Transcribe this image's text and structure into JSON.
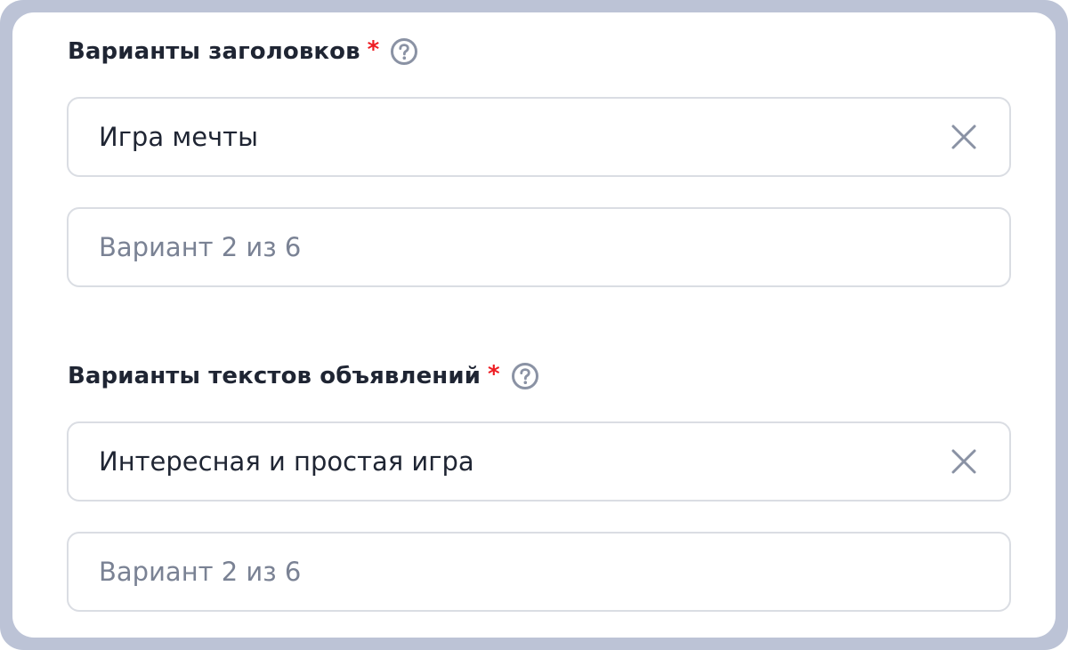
{
  "headlines": {
    "label": "Варианты заголовков",
    "required_mark": "*",
    "help_icon": "question-circle-icon",
    "fields": [
      {
        "value": "Игра мечты",
        "clear_icon": "close-icon"
      },
      {
        "placeholder": "Вариант 2 из 6"
      }
    ]
  },
  "ad_texts": {
    "label": "Варианты текстов объявлений",
    "required_mark": "*",
    "help_icon": "question-circle-icon",
    "fields": [
      {
        "value": "Интересная и простая игра",
        "clear_icon": "close-icon"
      },
      {
        "placeholder": "Вариант 2 из 6"
      }
    ]
  },
  "colors": {
    "frame": "#bcc3d6",
    "required": "#ee1d23",
    "text": "#1f2533",
    "placeholder": "#7a8294",
    "border": "#dadde3"
  }
}
